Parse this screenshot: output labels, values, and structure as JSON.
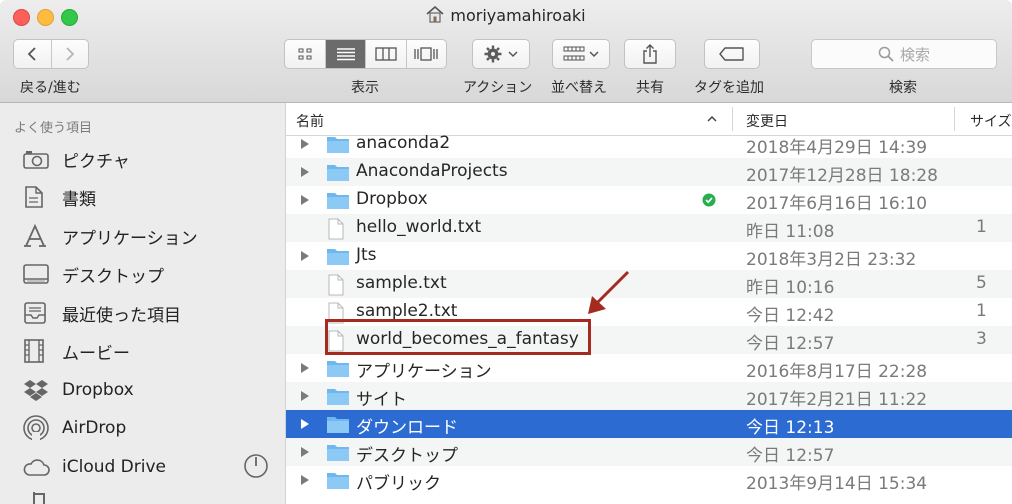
{
  "window": {
    "title": "moriyamahiroaki"
  },
  "toolbar": {
    "nav_label": "戻る/進む",
    "view_label": "表示",
    "action_label": "アクション",
    "sort_label": "並べ替え",
    "share_label": "共有",
    "tag_label": "タグを追加",
    "search_label": "検索",
    "search_placeholder": "検索"
  },
  "sidebar": {
    "header": "よく使う項目",
    "items": [
      {
        "label": "ピクチャ",
        "icon": "camera-icon"
      },
      {
        "label": "書類",
        "icon": "document-icon"
      },
      {
        "label": "アプリケーション",
        "icon": "applications-icon"
      },
      {
        "label": "デスクトップ",
        "icon": "desktop-icon"
      },
      {
        "label": "最近使った項目",
        "icon": "recents-icon"
      },
      {
        "label": "ムービー",
        "icon": "film-icon"
      },
      {
        "label": "Dropbox",
        "icon": "dropbox-icon"
      },
      {
        "label": "AirDrop",
        "icon": "airdrop-icon"
      },
      {
        "label": "iCloud Drive",
        "icon": "cloud-icon"
      }
    ]
  },
  "columns": {
    "name": "名前",
    "modified": "変更日",
    "size": "サイズ"
  },
  "rows": [
    {
      "name": "anaconda2",
      "date": "2018年4月29日 14:39",
      "type": "folder",
      "size": ""
    },
    {
      "name": "AnacondaProjects",
      "date": "2017年12月28日 18:28",
      "type": "folder",
      "size": ""
    },
    {
      "name": "Dropbox",
      "date": "2017年6月16日 16:10",
      "type": "folder",
      "size": ""
    },
    {
      "name": "hello_world.txt",
      "date": "昨日 11:08",
      "type": "file",
      "size": "1"
    },
    {
      "name": "Jts",
      "date": "2018年3月2日 23:32",
      "type": "folder",
      "size": ""
    },
    {
      "name": "sample.txt",
      "date": "昨日 10:16",
      "type": "file",
      "size": "5"
    },
    {
      "name": "sample2.txt",
      "date": "今日 12:42",
      "type": "file",
      "size": "1"
    },
    {
      "name": "world_becomes_a_fantasy",
      "date": "今日 12:57",
      "type": "file",
      "size": "3"
    },
    {
      "name": "アプリケーション",
      "date": "2016年8月17日 22:28",
      "type": "folder",
      "size": ""
    },
    {
      "name": "サイト",
      "date": "2017年2月21日 11:22",
      "type": "folder",
      "size": ""
    },
    {
      "name": "ダウンロード",
      "date": "今日 12:13",
      "type": "folder",
      "size": ""
    },
    {
      "name": "デスクトップ",
      "date": "今日 12:57",
      "type": "folder",
      "size": ""
    },
    {
      "name": "パブリック",
      "date": "2013年9月14日 15:34",
      "type": "folder",
      "size": ""
    }
  ],
  "colors": {
    "selection": "#2c6bd2",
    "annotation": "#a52a20",
    "folder": "#6fb8ef"
  }
}
